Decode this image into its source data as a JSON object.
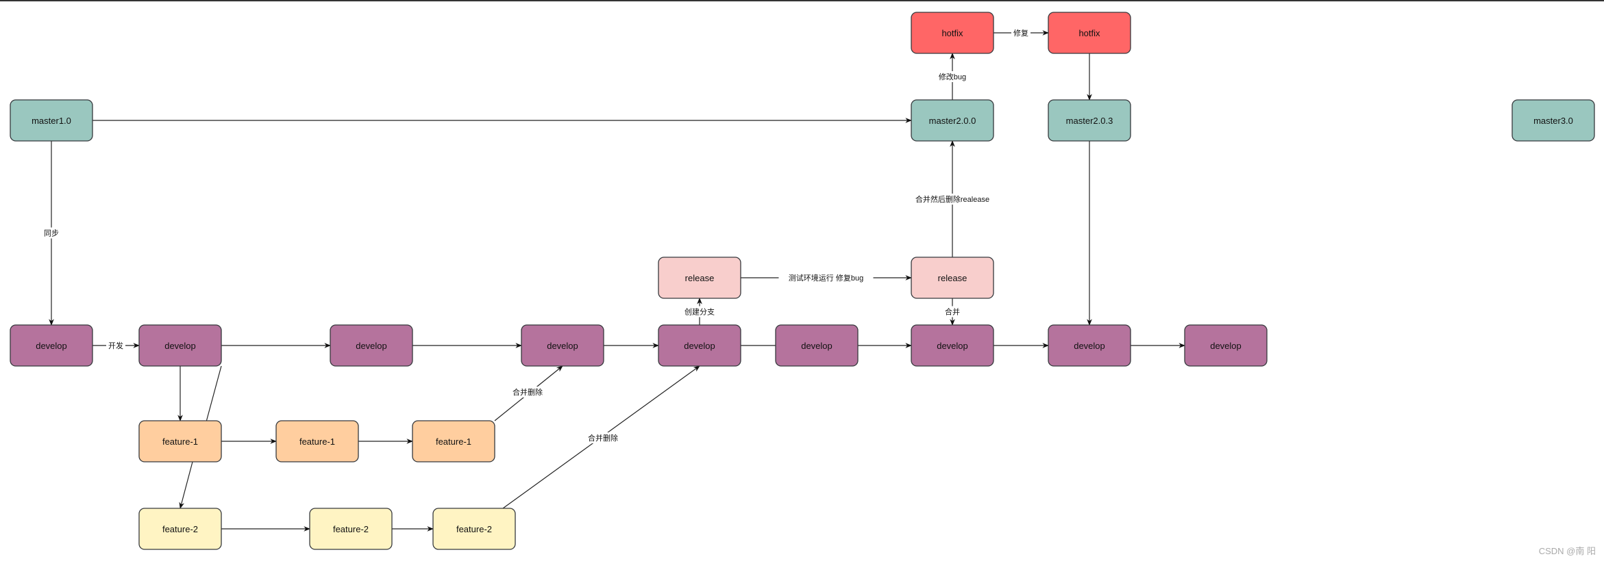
{
  "colors": {
    "master": "#9AC7BF",
    "develop": "#B5739D",
    "feature1": "#FFCE9F",
    "feature2": "#FFF4C3",
    "release": "#F8CECC",
    "hotfix": "#FF6666",
    "stroke": "#36393d"
  },
  "nodes": [
    {
      "id": "m1",
      "label": "master1.0",
      "type": "master"
    },
    {
      "id": "m200",
      "label": "master2.0.0",
      "type": "master"
    },
    {
      "id": "m203",
      "label": "master2.0.3",
      "type": "master"
    },
    {
      "id": "m3",
      "label": "master3.0",
      "type": "master"
    },
    {
      "id": "hf1",
      "label": "hotfix",
      "type": "hotfix"
    },
    {
      "id": "hf2",
      "label": "hotfix",
      "type": "hotfix"
    },
    {
      "id": "r1",
      "label": "release",
      "type": "release"
    },
    {
      "id": "r2",
      "label": "release",
      "type": "release"
    },
    {
      "id": "d1",
      "label": "develop",
      "type": "develop"
    },
    {
      "id": "d2",
      "label": "develop",
      "type": "develop"
    },
    {
      "id": "d3",
      "label": "develop",
      "type": "develop"
    },
    {
      "id": "d4",
      "label": "develop",
      "type": "develop"
    },
    {
      "id": "d5",
      "label": "develop",
      "type": "develop"
    },
    {
      "id": "d6",
      "label": "develop",
      "type": "develop"
    },
    {
      "id": "d7",
      "label": "develop",
      "type": "develop"
    },
    {
      "id": "d8",
      "label": "develop",
      "type": "develop"
    },
    {
      "id": "d9",
      "label": "develop",
      "type": "develop"
    },
    {
      "id": "f1a",
      "label": "feature-1",
      "type": "feature1"
    },
    {
      "id": "f1b",
      "label": "feature-1",
      "type": "feature1"
    },
    {
      "id": "f1c",
      "label": "feature-1",
      "type": "feature1"
    },
    {
      "id": "f2a",
      "label": "feature-2",
      "type": "feature2"
    },
    {
      "id": "f2b",
      "label": "feature-2",
      "type": "feature2"
    },
    {
      "id": "f2c",
      "label": "feature-2",
      "type": "feature2"
    }
  ],
  "edges": [
    {
      "from": "m1",
      "to": "d1",
      "label": "同步",
      "arrow": true
    },
    {
      "from": "m1",
      "to": "m200",
      "label": "",
      "arrow": true
    },
    {
      "from": "d1",
      "to": "d2",
      "label": "开发",
      "arrow": true
    },
    {
      "from": "d2",
      "to": "d3",
      "label": "",
      "arrow": true
    },
    {
      "from": "d3",
      "to": "d4",
      "label": "",
      "arrow": true
    },
    {
      "from": "d4",
      "to": "d5",
      "label": "",
      "arrow": true
    },
    {
      "from": "d5",
      "to": "d6",
      "label": "",
      "arrow": false
    },
    {
      "from": "d6",
      "to": "d7",
      "label": "",
      "arrow": true
    },
    {
      "from": "d7",
      "to": "d8",
      "label": "",
      "arrow": true
    },
    {
      "from": "d8",
      "to": "d9",
      "label": "",
      "arrow": true
    },
    {
      "from": "d2",
      "to": "f1a",
      "label": "",
      "arrow": true
    },
    {
      "from": "d2",
      "to": "f1a",
      "label": "",
      "arrow": false,
      "variant": "skew"
    },
    {
      "from": "f1a",
      "to": "f2a",
      "label": "",
      "arrow": true
    },
    {
      "from": "f1a",
      "to": "f1b",
      "label": "",
      "arrow": true
    },
    {
      "from": "f1b",
      "to": "f1c",
      "label": "",
      "arrow": true
    },
    {
      "from": "f2a",
      "to": "f2b",
      "label": "",
      "arrow": true
    },
    {
      "from": "f2b",
      "to": "f2c",
      "label": "",
      "arrow": true
    },
    {
      "from": "f1c",
      "to": "d4",
      "label": "合并删除",
      "arrow": true
    },
    {
      "from": "f2c",
      "to": "d5",
      "label": "合并删除",
      "arrow": true
    },
    {
      "from": "d5",
      "to": "r1",
      "label": "创建分支",
      "arrow": true
    },
    {
      "from": "r1",
      "to": "r2",
      "label": "测试环境运行 修复bug",
      "arrow": true
    },
    {
      "from": "r2",
      "to": "m200",
      "label": "合并然后删除realease",
      "arrow": true
    },
    {
      "from": "r2",
      "to": "d7",
      "label": "合并",
      "arrow": true
    },
    {
      "from": "m200",
      "to": "hf1",
      "label": "修改bug",
      "arrow": true
    },
    {
      "from": "hf1",
      "to": "hf2",
      "label": "修复",
      "arrow": true
    },
    {
      "from": "hf2",
      "to": "m203",
      "label": "",
      "arrow": true
    },
    {
      "from": "m203",
      "to": "d8",
      "label": "",
      "arrow": true
    }
  ],
  "watermark": "CSDN @南 阳"
}
